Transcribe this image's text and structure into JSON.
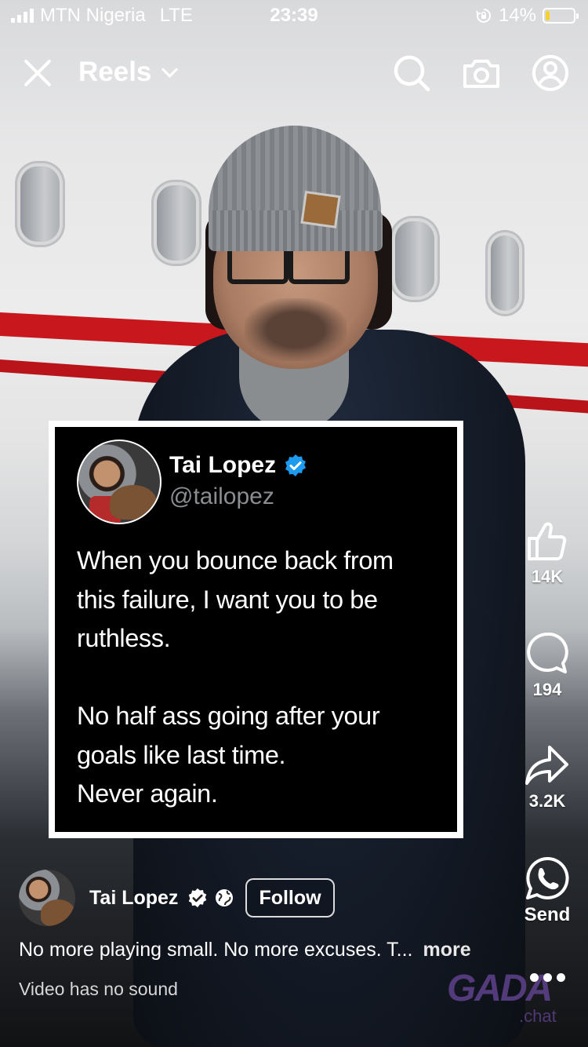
{
  "status_bar": {
    "carrier": "MTN Nigeria",
    "network": "LTE",
    "time": "23:39",
    "battery_percent_label": "14%",
    "battery_level": 0.14,
    "battery_color": "#f5d130",
    "icons": [
      "signal-icon",
      "orientation-lock-icon",
      "battery-icon"
    ]
  },
  "top_nav": {
    "title": "Reels",
    "icons": [
      "close-icon",
      "chevron-down-icon",
      "search-icon",
      "camera-icon",
      "profile-icon"
    ]
  },
  "tweet_card": {
    "name": "Tai Lopez",
    "handle": "@tailopez",
    "verified_color": "#1d9bf0",
    "paragraph_1": [
      "When you bounce back from",
      "this failure, I want you to be",
      "ruthless."
    ],
    "paragraph_2": [
      "No half ass going after your",
      "goals like last time.",
      "Never again."
    ]
  },
  "actions": {
    "like_count": "14K",
    "comment_count": "194",
    "share_count": "3.2K",
    "send_label": "Send"
  },
  "author": {
    "name": "Tai Lopez",
    "follow_label": "Follow",
    "icons": [
      "verified-badge-icon",
      "globe-icon"
    ]
  },
  "caption": {
    "text": "No more playing small. No more excuses. T...",
    "more_label": "more"
  },
  "audio_status": "Video has no sound",
  "watermark": {
    "main": "GADA",
    "sub": ".chat"
  }
}
